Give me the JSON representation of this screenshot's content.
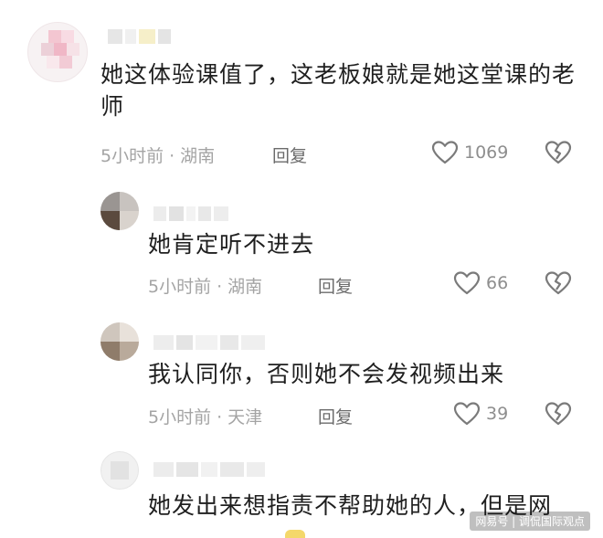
{
  "comments": [
    {
      "text": "她这体验课值了，这老板娘就是她这堂课的老师",
      "time": "5小时前",
      "sep": "·",
      "location": "湖南",
      "reply_label": "回复",
      "likes": "1069"
    },
    {
      "text": "她肯定听不进去",
      "time": "5小时前",
      "sep": "·",
      "location": "湖南",
      "reply_label": "回复",
      "likes": "66"
    },
    {
      "text": "我认同你，否则她不会发视频出来",
      "time": "5小时前",
      "sep": "·",
      "location": "天津",
      "reply_label": "回复",
      "likes": "39"
    },
    {
      "text": "她发出来想指责不帮助她的人，但是网"
    }
  ],
  "watermark": "网易号 | 调侃国际观点",
  "icons": {
    "like": "heart-outline-icon",
    "dislike": "broken-heart-icon"
  },
  "colors": {
    "text": "#1f1f1f",
    "meta": "#a4a4a4",
    "icon": "#7a7a7a"
  }
}
